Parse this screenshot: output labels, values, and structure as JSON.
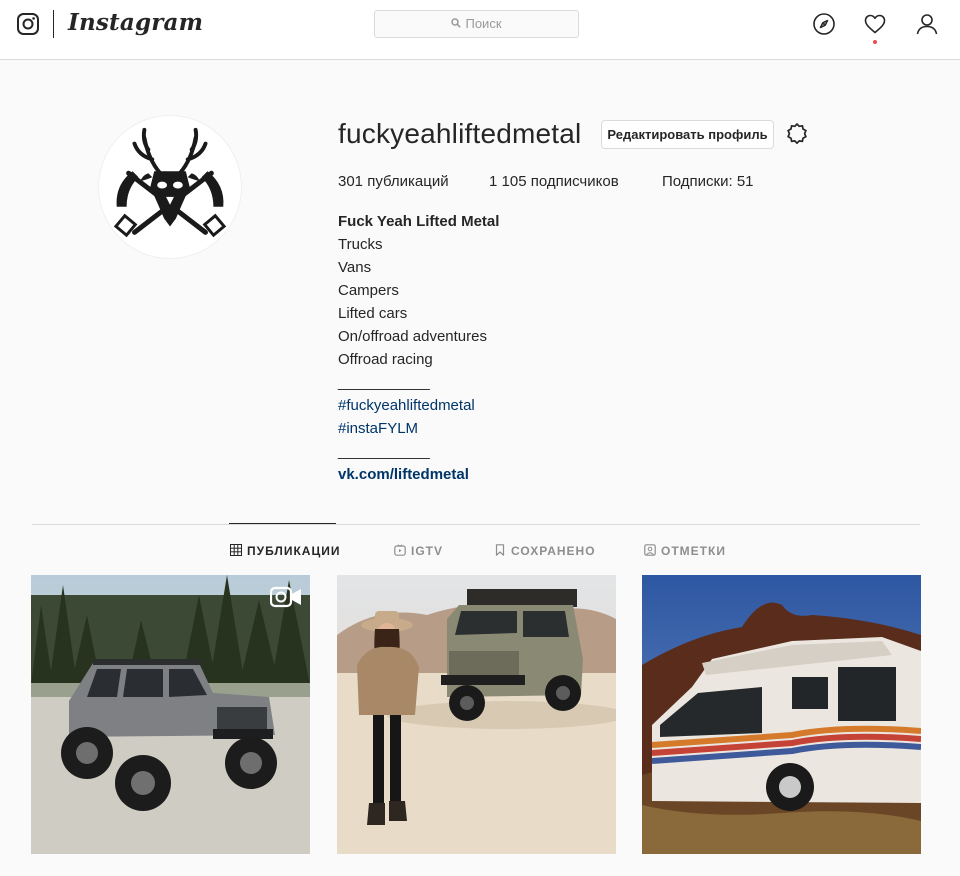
{
  "nav": {
    "wordmark": "Instagram",
    "search_placeholder": "Поиск",
    "icons": [
      "instagram-glyph-icon",
      "search-icon",
      "compass-icon",
      "heart-icon",
      "person-icon"
    ],
    "notification_dot_color": "#ed4956"
  },
  "profile": {
    "username": "fuckyeahliftedmetal",
    "edit_button": "Редактировать профиль",
    "settings_icon": "gear-icon",
    "stats": {
      "posts": "301 публикаций",
      "followers": "1 105 подписчиков",
      "following": "Подписки: 51"
    },
    "bio": {
      "name": "Fuck Yeah Lifted Metal",
      "lines": [
        "Trucks",
        "Vans",
        "Campers",
        "Lifted cars",
        "On/offroad adventures",
        "Offroad racing"
      ],
      "divider1": "___________",
      "hashtags": [
        "#fuckyeahliftedmetal",
        "#instaFYLM"
      ],
      "divider2": "___________",
      "link": "vk.com/liftedmetal"
    }
  },
  "tabs": [
    {
      "label": "ПУБЛИКАЦИИ",
      "icon": "grid-icon",
      "active": true
    },
    {
      "label": "IGTV",
      "icon": "igtv-icon",
      "active": false
    },
    {
      "label": "СОХРАНЕНО",
      "icon": "bookmark-icon",
      "active": false
    },
    {
      "label": "ОТМЕТКИ",
      "icon": "tag-icon",
      "active": false
    }
  ],
  "posts": [
    {
      "kind": "video",
      "badge_icon": "video-camera-icon"
    },
    {
      "kind": "photo"
    },
    {
      "kind": "photo"
    }
  ],
  "colors": {
    "link": "#003569",
    "text": "#262626",
    "muted": "#8e8e8e",
    "border": "#dbdbdb",
    "background": "#fafafa"
  }
}
